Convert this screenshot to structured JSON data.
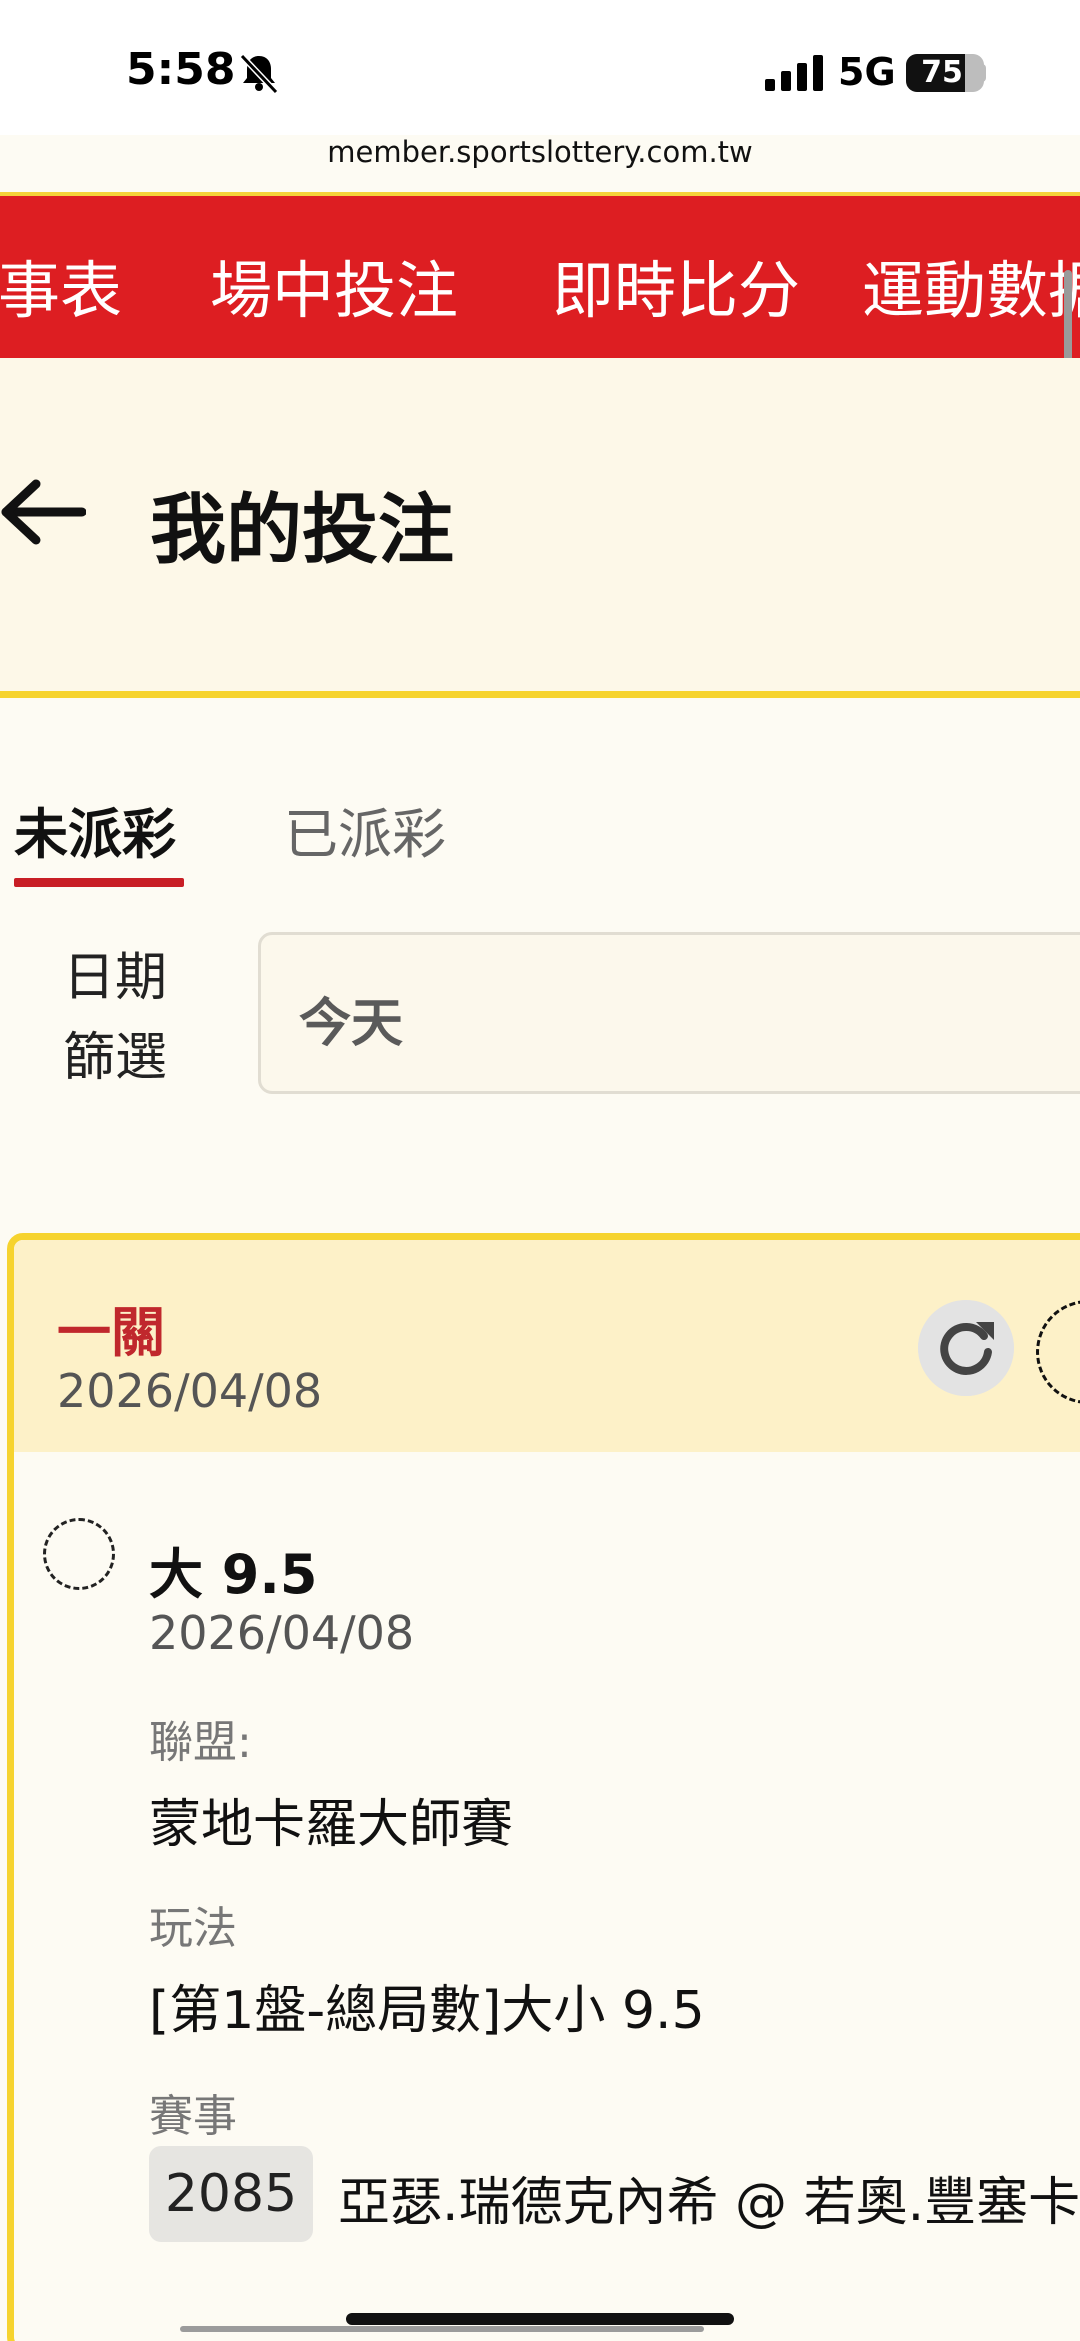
{
  "status_bar": {
    "time": "5:58",
    "network": "5G",
    "battery_level": 75,
    "battery_text": "75"
  },
  "browser": {
    "url": "member.sportslottery.com.tw"
  },
  "nav": {
    "items": [
      {
        "label": "事表"
      },
      {
        "label": "場中投注"
      },
      {
        "label": "即時比分"
      },
      {
        "label": "運動數据"
      }
    ],
    "background": "#dd1e22"
  },
  "header": {
    "title": "我的投注",
    "back_icon": "arrow-left-icon"
  },
  "tabs": [
    {
      "label": "未派彩",
      "active": true
    },
    {
      "label": "已派彩",
      "active": false
    }
  ],
  "filter": {
    "label_line1": "日期",
    "label_line2": "篩選",
    "value": "今天"
  },
  "bet": {
    "type": "一關",
    "date": "2026/04/08",
    "selection": {
      "name": "大 9.5",
      "date": "2026/04/08",
      "league_label": "聯盟:",
      "league": "蒙地卡羅大師賽",
      "play_label": "玩法",
      "play": "[第1盤-總局數]大小 9.5",
      "event_label": "賽事",
      "event_id": "2085",
      "event_name": "亞瑟.瑞德克內希 @ 若奧.豐塞卡"
    }
  },
  "colors": {
    "accent": "#dd1e22",
    "highlight": "#f6d32e",
    "card_header": "#fdf1c8"
  }
}
